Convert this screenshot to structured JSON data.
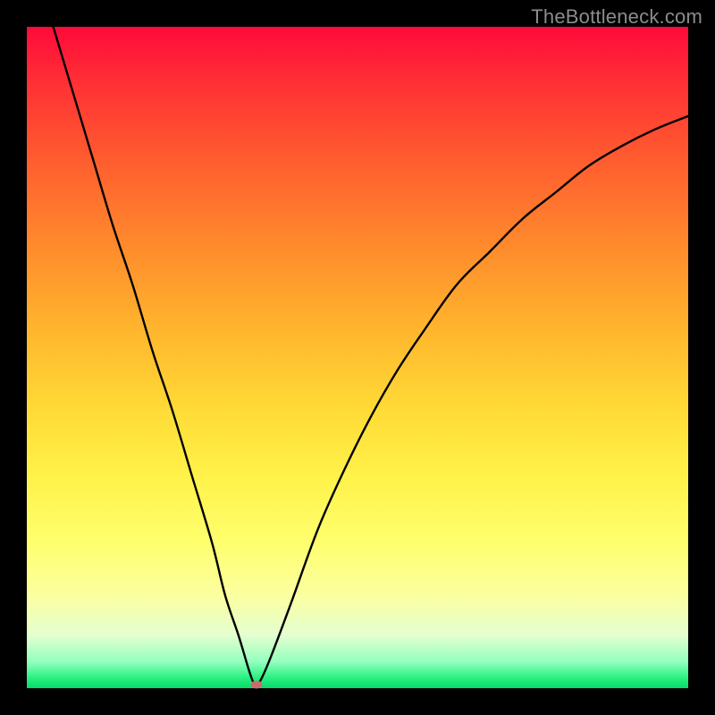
{
  "watermark": "TheBottleneck.com",
  "chart_data": {
    "type": "line",
    "title": "",
    "xlabel": "",
    "ylabel": "",
    "xlim": [
      0,
      100
    ],
    "ylim": [
      0,
      100
    ],
    "grid": false,
    "legend": null,
    "series": [
      {
        "name": "curve",
        "color": "#000000",
        "x": [
          4,
          7,
          10,
          13,
          16,
          19,
          22,
          25,
          28,
          30,
          32,
          33.5,
          34.2,
          34.7,
          35.5,
          37,
          40,
          44,
          48,
          52,
          56,
          60,
          65,
          70,
          75,
          80,
          85,
          90,
          95,
          100
        ],
        "y": [
          100,
          90,
          80,
          70,
          61,
          51,
          42,
          32,
          22,
          14,
          8,
          3,
          1,
          0.5,
          1.5,
          5,
          13,
          24,
          33,
          41,
          48,
          54,
          61,
          66,
          71,
          75,
          79,
          82,
          84.5,
          86.5
        ]
      }
    ],
    "marker": {
      "x": 34.7,
      "y": 0.5,
      "color": "#c96c6c"
    }
  }
}
